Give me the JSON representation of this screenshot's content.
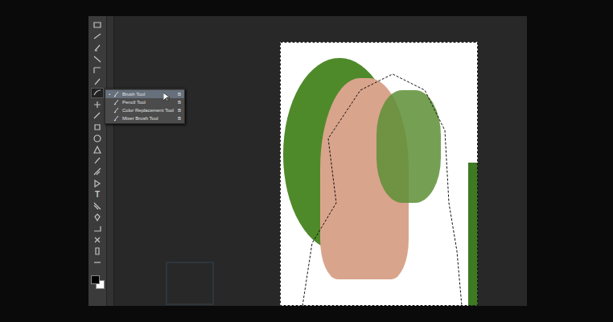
{
  "toolbar": {
    "type_tool_glyph": "T"
  },
  "flyout_menu": {
    "items": [
      {
        "label": "Brush Tool",
        "shortcut": "B",
        "selected": true
      },
      {
        "label": "Pencil Tool",
        "shortcut": "B",
        "selected": false
      },
      {
        "label": "Color Replacement Tool",
        "shortcut": "B",
        "selected": false
      },
      {
        "label": "Mixer Brush Tool",
        "shortcut": "B",
        "selected": false
      }
    ]
  }
}
